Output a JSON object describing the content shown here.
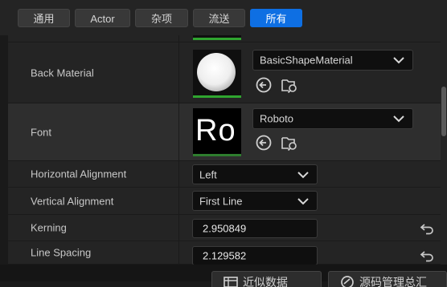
{
  "tabs": [
    {
      "label": "通用",
      "active": false
    },
    {
      "label": "Actor",
      "active": false
    },
    {
      "label": "杂项",
      "active": false
    },
    {
      "label": "流送",
      "active": false
    },
    {
      "label": "所有",
      "active": true
    }
  ],
  "properties": {
    "back_material": {
      "label": "Back Material",
      "value": "BasicShapeMaterial",
      "thumbnail_icon": "white-sphere-material-icon"
    },
    "font": {
      "label": "Font",
      "value": "Roboto",
      "preview_text": "Ro"
    },
    "horizontal_alignment": {
      "label": "Horizontal Alignment",
      "value": "Left"
    },
    "vertical_alignment": {
      "label": "Vertical Alignment",
      "value": "First Line"
    },
    "kerning": {
      "label": "Kerning",
      "value": "2.950849"
    },
    "line_spacing": {
      "label": "Line Spacing",
      "value": "2.129582"
    }
  },
  "icons": {
    "use_selected": "arrow-left-circle-icon",
    "browse": "folder-search-icon",
    "reset": "reset-arrow-icon",
    "dropdown": "chevron-down-icon"
  },
  "bottom_tabs": [
    {
      "label": "近似数据",
      "icon": "table-icon"
    },
    {
      "label": "源码管理总汇",
      "icon": "source-control-icon"
    }
  ],
  "colors": {
    "accent": "#0e6fe3",
    "thumbnail_valid": "#2fa52f",
    "panel_bg": "#242424",
    "field_bg": "#0f0f0f"
  }
}
